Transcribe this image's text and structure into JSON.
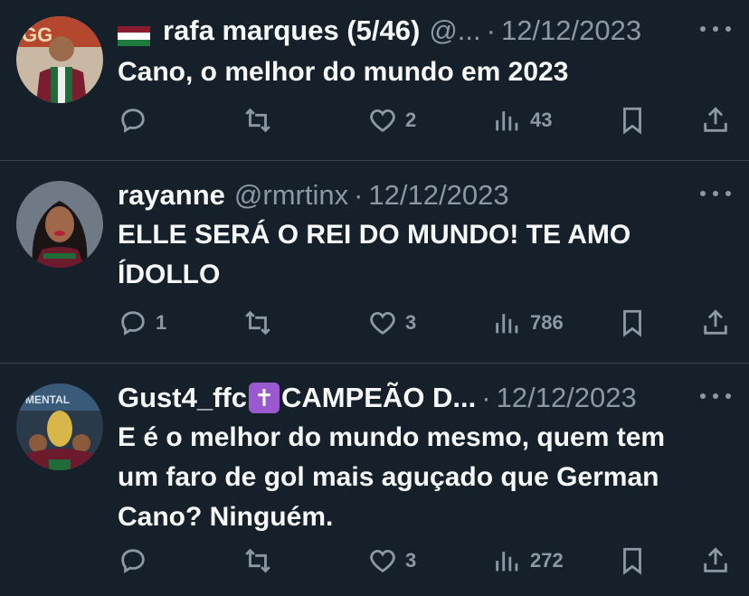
{
  "tweets": [
    {
      "name": "rafa marques (5/46)",
      "handle": "@...",
      "separator": "·",
      "date": "12/12/2023",
      "text": "Cano, o melhor do mundo em 2023",
      "replies": "",
      "likes": "2",
      "views": "43"
    },
    {
      "name": "rayanne",
      "handle": "@rmrtinx",
      "separator": "·",
      "date": "12/12/2023",
      "text": "ELLE SERÁ O REI DO MUNDO! TE AMO\nÍDOLLO",
      "replies": "1",
      "likes": "3",
      "views": "786"
    },
    {
      "name_prefix": "Gust4_ffc",
      "cross_glyph": "✝",
      "name_suffix": "CAMPEÃO D...",
      "separator": "·",
      "date": "12/12/2023",
      "text": "E é o melhor do mundo mesmo, quem tem\num faro de gol mais aguçado que German\nCano? Ninguém.",
      "replies": "",
      "likes": "3",
      "views": "272"
    }
  ],
  "colors": {
    "background": "#15202b",
    "text_primary": "#f7f9f9",
    "text_secondary": "#8b98a5",
    "divider": "#38444d"
  },
  "icons": [
    "more-icon",
    "reply-icon",
    "retweet-icon",
    "like-icon",
    "views-icon",
    "bookmark-icon",
    "share-icon",
    "flag-icon"
  ]
}
